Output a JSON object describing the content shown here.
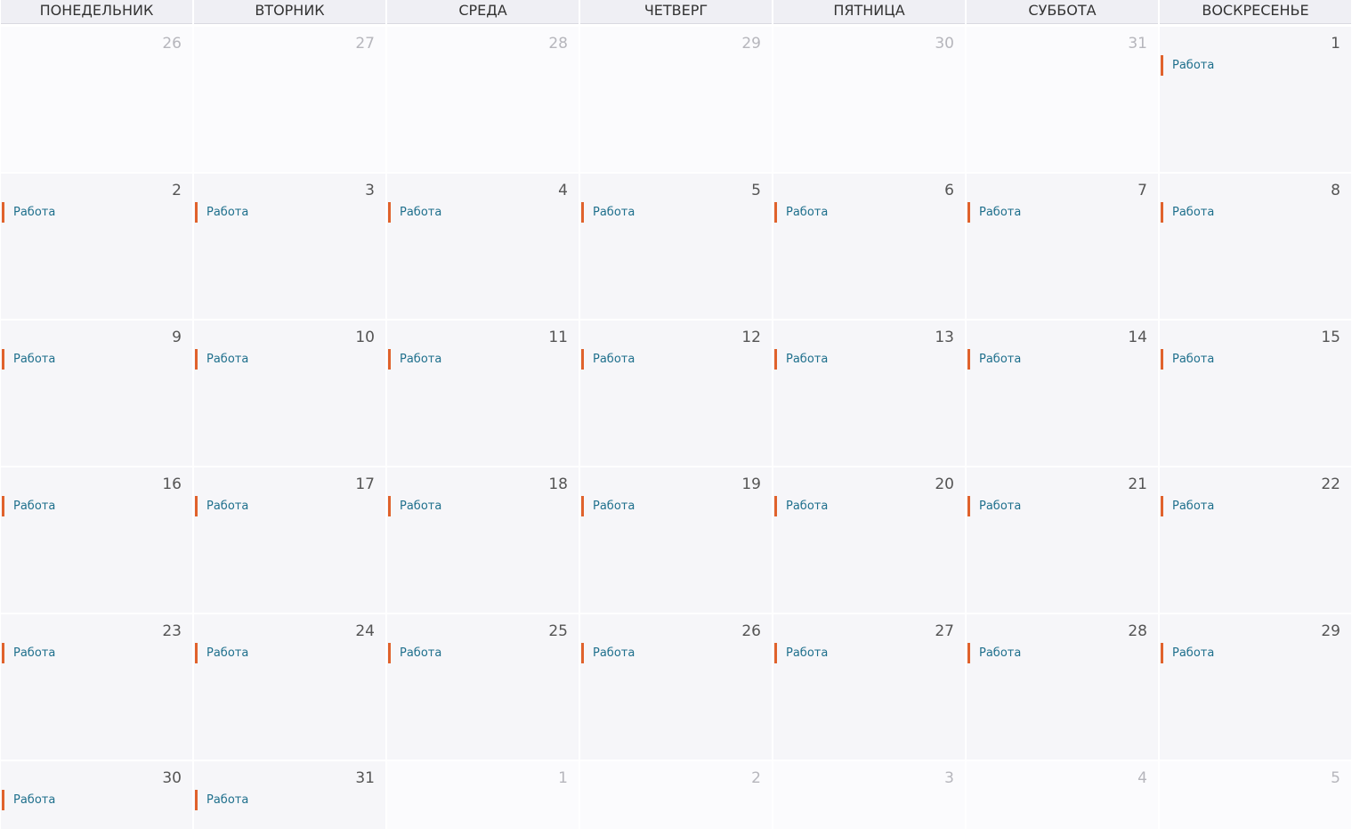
{
  "headers": [
    "ПОНЕДЕЛЬНИК",
    "ВТОРНИК",
    "СРЕДА",
    "ЧЕТВЕРГ",
    "ПЯТНИЦА",
    "СУББОТА",
    "ВОСКРЕСЕНЬЕ"
  ],
  "event_color": "#e0622c",
  "event_text_color": "#1e6f8c",
  "weeks": [
    [
      {
        "day": "26",
        "current": false,
        "event": ""
      },
      {
        "day": "27",
        "current": false,
        "event": ""
      },
      {
        "day": "28",
        "current": false,
        "event": ""
      },
      {
        "day": "29",
        "current": false,
        "event": ""
      },
      {
        "day": "30",
        "current": false,
        "event": ""
      },
      {
        "day": "31",
        "current": false,
        "event": ""
      },
      {
        "day": "1",
        "current": true,
        "event": "Работа"
      }
    ],
    [
      {
        "day": "2",
        "current": true,
        "event": "Работа"
      },
      {
        "day": "3",
        "current": true,
        "event": "Работа"
      },
      {
        "day": "4",
        "current": true,
        "event": "Работа"
      },
      {
        "day": "5",
        "current": true,
        "event": "Работа"
      },
      {
        "day": "6",
        "current": true,
        "event": "Работа"
      },
      {
        "day": "7",
        "current": true,
        "event": "Работа"
      },
      {
        "day": "8",
        "current": true,
        "event": "Работа"
      }
    ],
    [
      {
        "day": "9",
        "current": true,
        "event": "Работа"
      },
      {
        "day": "10",
        "current": true,
        "event": "Работа"
      },
      {
        "day": "11",
        "current": true,
        "event": "Работа"
      },
      {
        "day": "12",
        "current": true,
        "event": "Работа"
      },
      {
        "day": "13",
        "current": true,
        "event": "Работа"
      },
      {
        "day": "14",
        "current": true,
        "event": "Работа"
      },
      {
        "day": "15",
        "current": true,
        "event": "Работа"
      }
    ],
    [
      {
        "day": "16",
        "current": true,
        "event": "Работа"
      },
      {
        "day": "17",
        "current": true,
        "event": "Работа"
      },
      {
        "day": "18",
        "current": true,
        "event": "Работа"
      },
      {
        "day": "19",
        "current": true,
        "event": "Работа"
      },
      {
        "day": "20",
        "current": true,
        "event": "Работа"
      },
      {
        "day": "21",
        "current": true,
        "event": "Работа"
      },
      {
        "day": "22",
        "current": true,
        "event": "Работа"
      }
    ],
    [
      {
        "day": "23",
        "current": true,
        "event": "Работа"
      },
      {
        "day": "24",
        "current": true,
        "event": "Работа"
      },
      {
        "day": "25",
        "current": true,
        "event": "Работа"
      },
      {
        "day": "26",
        "current": true,
        "event": "Работа"
      },
      {
        "day": "27",
        "current": true,
        "event": "Работа"
      },
      {
        "day": "28",
        "current": true,
        "event": "Работа"
      },
      {
        "day": "29",
        "current": true,
        "event": "Работа"
      }
    ],
    [
      {
        "day": "30",
        "current": true,
        "event": "Работа"
      },
      {
        "day": "31",
        "current": true,
        "event": "Работа"
      },
      {
        "day": "1",
        "current": false,
        "event": ""
      },
      {
        "day": "2",
        "current": false,
        "event": ""
      },
      {
        "day": "3",
        "current": false,
        "event": ""
      },
      {
        "day": "4",
        "current": false,
        "event": ""
      },
      {
        "day": "5",
        "current": false,
        "event": ""
      }
    ]
  ]
}
